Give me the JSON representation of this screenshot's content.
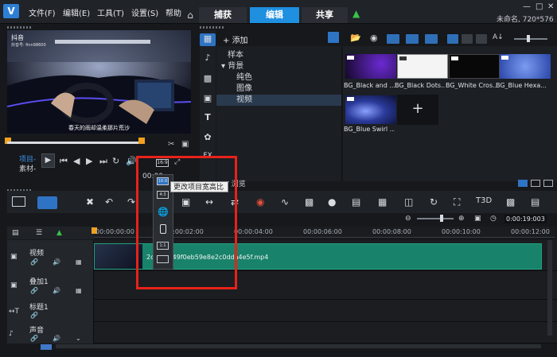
{
  "menu": {
    "file": "文件(F)",
    "edit": "编辑(E)",
    "tools": "工具(T)",
    "settings": "设置(S)",
    "help": "帮助"
  },
  "tabs": {
    "capture": "捕获",
    "edit": "编辑",
    "share": "共享"
  },
  "project_info": "未命名, 720*576",
  "preview": {
    "caption": "春天的雨却温柔那片荒沙",
    "watermark_brand": "抖音",
    "watermark_id": "抖音号: finn98600",
    "mode_project": "项目-",
    "mode_clip": "素材-",
    "ratio_label": "16:9",
    "timecode": "00:00:"
  },
  "library": {
    "add_label": "添加",
    "tree": [
      "样本",
      "背景",
      "纯色",
      "图像",
      "视频"
    ],
    "selected": "视频",
    "thumbnails": [
      {
        "label": "BG_Black and ...",
        "color": "#2a1040"
      },
      {
        "label": "BG_Black Dots...",
        "color": "#f4f4f4"
      },
      {
        "label": "BG_White Cros...",
        "color": "#080808"
      },
      {
        "label": "BG_Blue Hexa...",
        "color": "#4a6ed0"
      },
      {
        "label": "BG_Blue Swirl ...",
        "color": "#2a3a9a"
      }
    ],
    "add_tile": "+",
    "browse": "浏览"
  },
  "popup": {
    "options": [
      "16:9",
      "4:3",
      "globe",
      "phone",
      "1:1",
      "img"
    ],
    "tooltip": "更改项目宽高比"
  },
  "timeline": {
    "ticks": [
      "00:00:00:00",
      "00:00:02:00",
      "00:00:04:00",
      "00:00:06:00",
      "00:00:08:00",
      "00:00:10:00",
      "00:00:12:00"
    ],
    "time_display": "0:00:19:003",
    "tracks": [
      "视频",
      "叠加1",
      "标题1",
      "声音"
    ],
    "clip_name": "2c4f03949f0eb59e8e2c0dda4e5f.mp4"
  }
}
